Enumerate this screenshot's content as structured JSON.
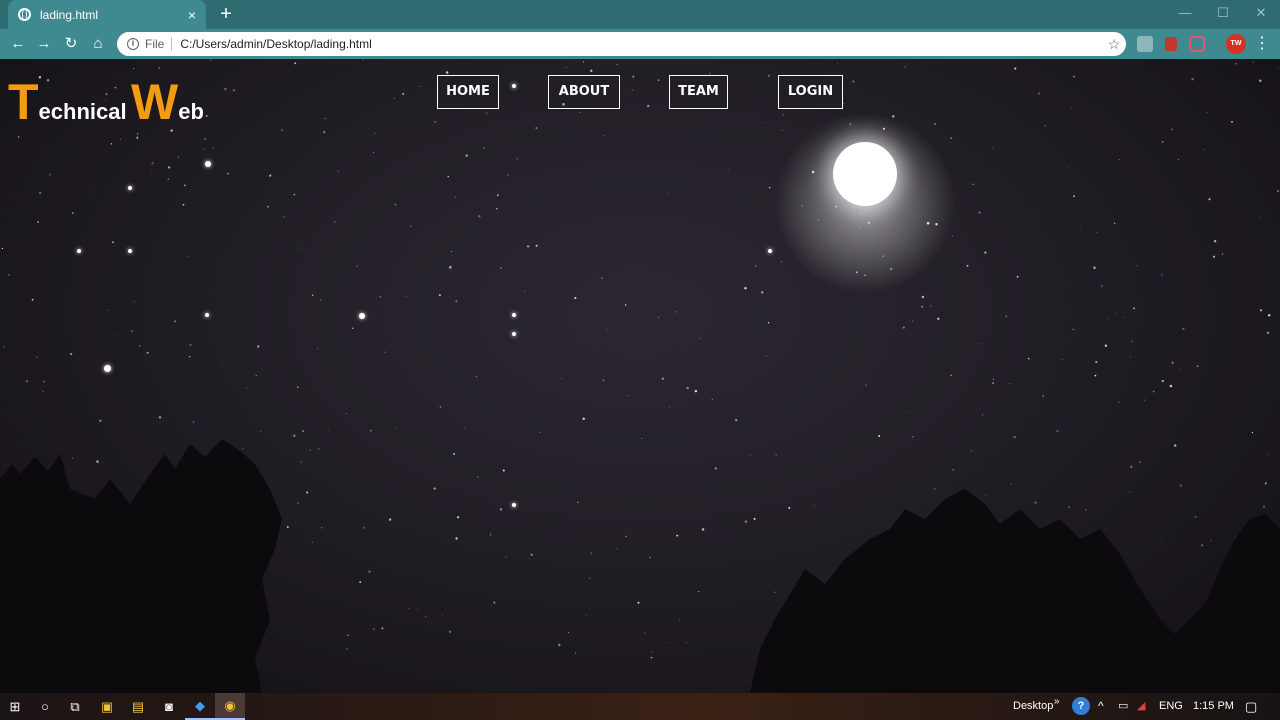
{
  "browser": {
    "tab_title": "lading.html",
    "tab_close": "×",
    "new_tab": "+",
    "address_scheme": "File",
    "address_url": "C:/Users/admin/Desktop/lading.html",
    "profile_initials": "TW"
  },
  "page": {
    "logo": {
      "first_initial": "T",
      "first_rest": "echnical",
      "second_initial": "W",
      "second_rest": "eb"
    },
    "nav": {
      "home": "HOME",
      "about": "ABOUT",
      "team": "TEAM",
      "login": "LOGIN"
    },
    "colors": {
      "logo_accent": "#f39c12",
      "nav_border": "#ffffff",
      "sky": "#221e26"
    }
  },
  "taskbar": {
    "desktop_label": "Desktop",
    "language": "ENG",
    "time": "1:15 PM"
  }
}
